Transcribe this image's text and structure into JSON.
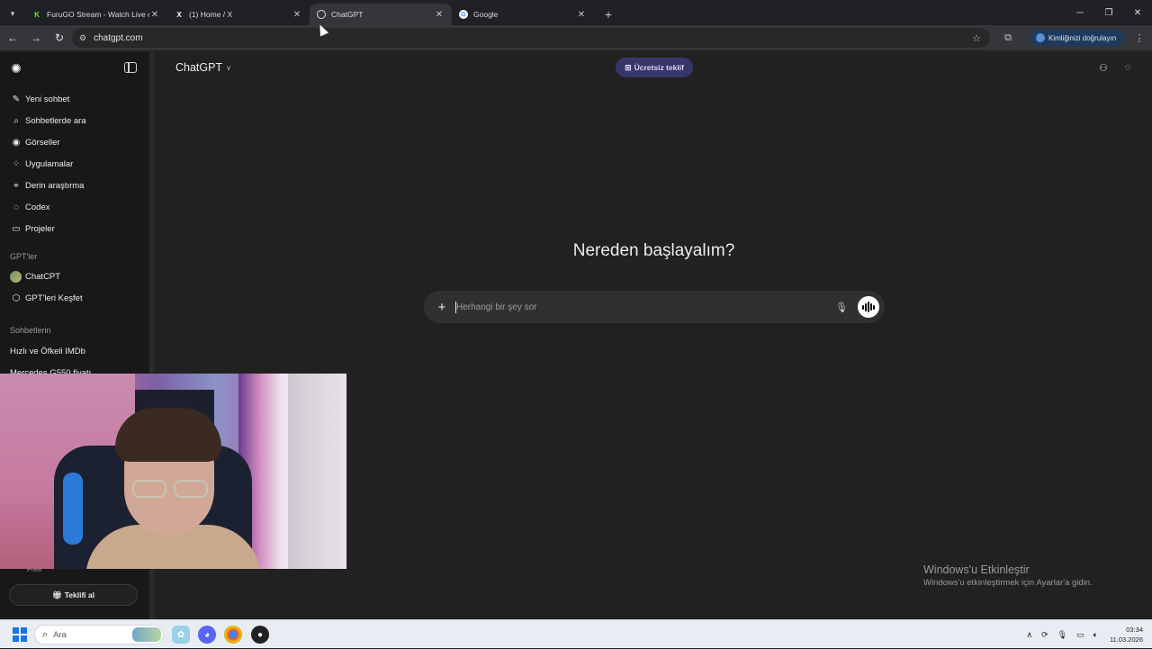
{
  "browser": {
    "tabs": [
      {
        "title": "FuruGO Stream - Watch Live o",
        "favicon": "K",
        "favicon_color": "#53fc18",
        "active": false
      },
      {
        "title": "(1) Home / X",
        "favicon": "X",
        "favicon_color": "#000000",
        "active": false
      },
      {
        "title": "ChatGPT",
        "favicon": "openai-icon",
        "favicon_color": "#ffffff",
        "active": true
      },
      {
        "title": "Google",
        "favicon": "G",
        "favicon_color": "#4285f4",
        "active": false
      }
    ],
    "url": "chatgpt.com",
    "verify_label": "Kimliğinizi doğrulayın"
  },
  "sidebar": {
    "items": [
      {
        "label": "Yeni sohbet",
        "icon": "edit-icon"
      },
      {
        "label": "Sohbetlerde ara",
        "icon": "search-icon"
      },
      {
        "label": "Görseller",
        "icon": "image-icon"
      },
      {
        "label": "Uygulamalar",
        "icon": "apps-icon"
      },
      {
        "label": "Derin araştırma",
        "icon": "telescope-icon"
      },
      {
        "label": "Codex",
        "icon": "codex-icon"
      },
      {
        "label": "Projeler",
        "icon": "folder-icon"
      }
    ],
    "gpts_section": "GPT'ler",
    "gpts": [
      {
        "label": "ChatCPT",
        "icon": "gpt-avatar"
      },
      {
        "label": "GPT'leri Keşfet",
        "icon": "cube-icon"
      }
    ],
    "chats_section": "Sohbetlerin",
    "chats": [
      "Hızlı ve Öfkeli IMDb",
      "Mercedes G550 fiyatı"
    ],
    "plan": "Free",
    "offer_button": "Teklifi al"
  },
  "header": {
    "model": "ChatGPT",
    "free_offer": "Ücretsiz teklif"
  },
  "main": {
    "heading": "Nereden başlayalım?",
    "composer_placeholder": "Herhangi bir şey sor"
  },
  "watermark": {
    "title": "Windows'u Etkinleştir",
    "subtitle": "Windows'u etkinleştirmek için Ayarlar'a gidin."
  },
  "taskbar": {
    "search_placeholder": "Ara",
    "time": "03:34",
    "date": "11.03.2026"
  },
  "colors": {
    "background": "#212121",
    "sidebar": "#181818",
    "accent_offer": "#373669"
  }
}
